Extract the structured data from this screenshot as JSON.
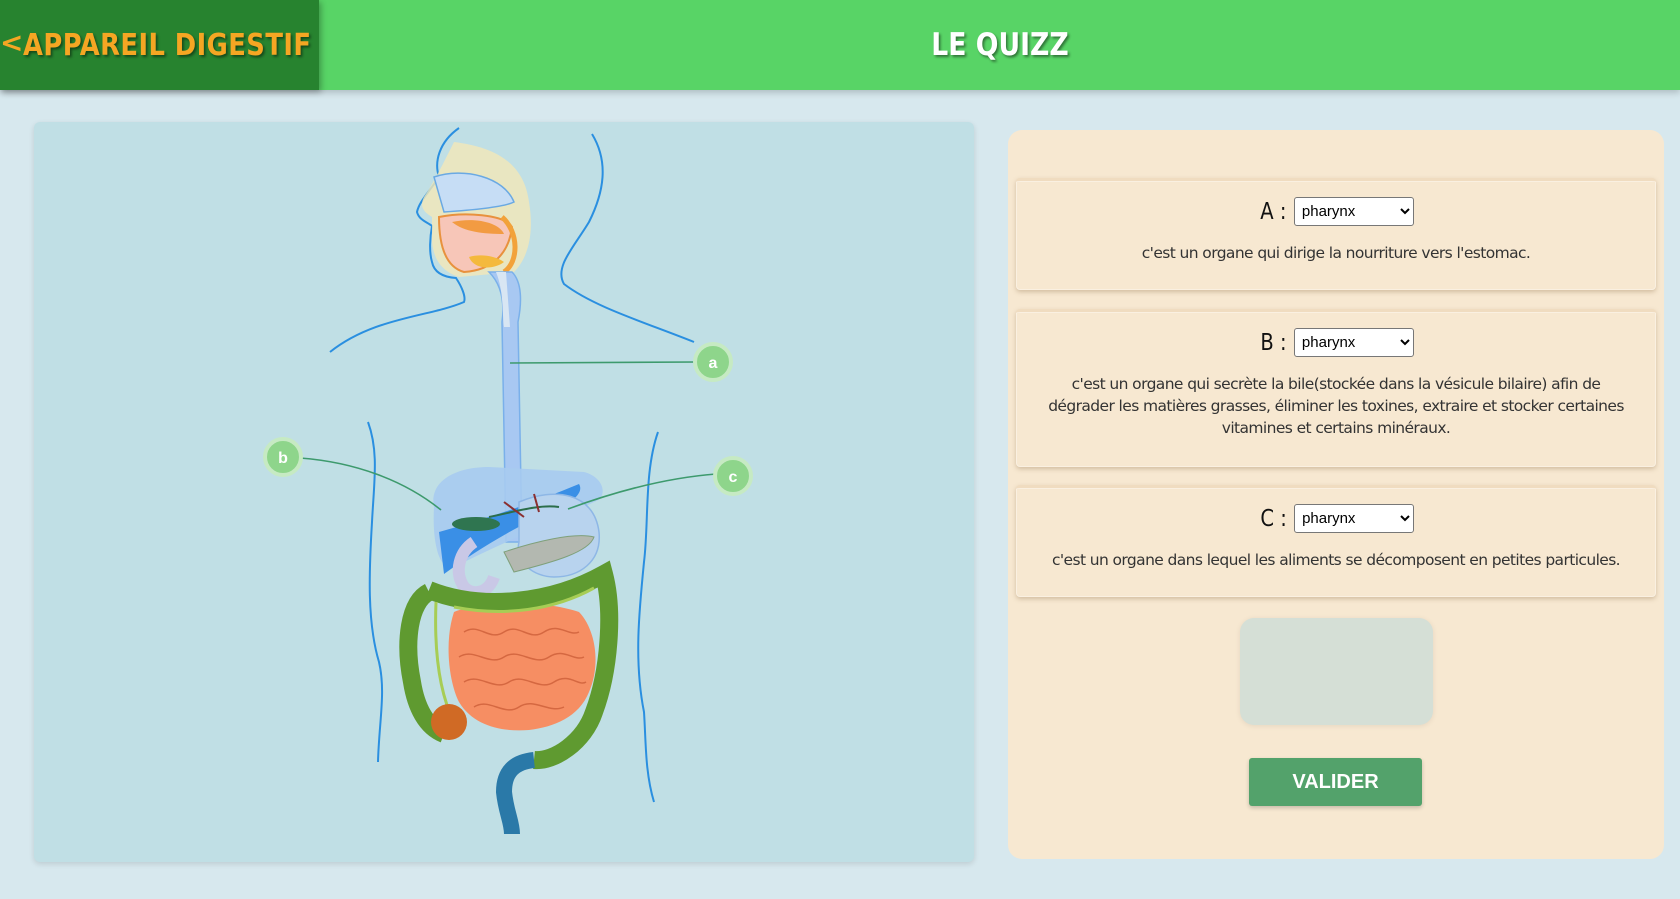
{
  "header": {
    "back_icon": "chevron-left-icon",
    "back_label": "APPAREIL DIGESTIF",
    "title": "LE QUIZZ",
    "colors": {
      "header_bg": "#58d466",
      "back_bg": "#27832f",
      "accent": "#f5a623"
    }
  },
  "diagram": {
    "markers": [
      "a",
      "b",
      "c"
    ]
  },
  "quiz": {
    "questions": [
      {
        "letter": "A :",
        "selected": "pharynx",
        "text": "c'est un organe qui dirige la nourriture vers l'estomac."
      },
      {
        "letter": "B :",
        "selected": "pharynx",
        "text": "c'est un organe qui secrète la bile(stockée dans la vésicule bilaire) afin de dégrader les matières grasses, éliminer les toxines, extraire et stocker certaines vitamines et certains minéraux."
      },
      {
        "letter": "C :",
        "selected": "pharynx",
        "text": "c'est un organe dans lequel les aliments se décomposent en petites particules."
      }
    ],
    "validate_label": "VALIDER"
  }
}
